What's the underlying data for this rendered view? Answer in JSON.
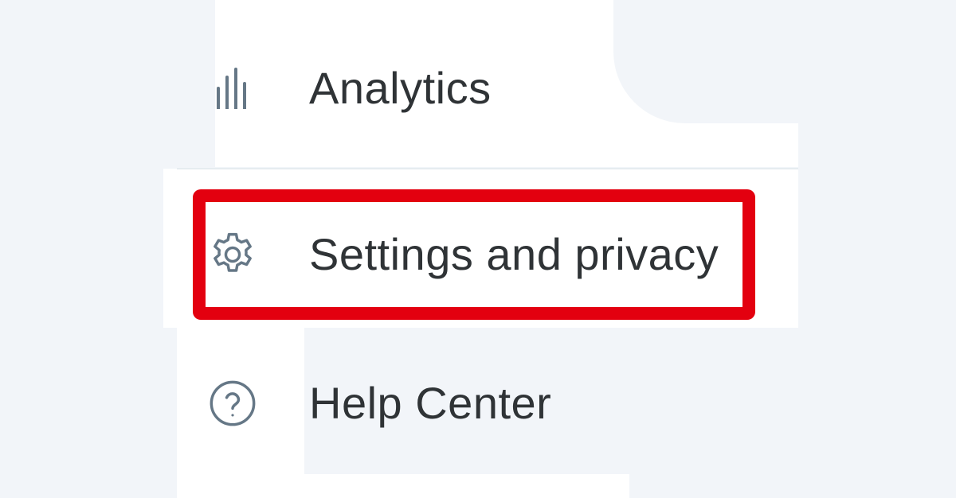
{
  "menu": {
    "items": [
      {
        "label": "Analytics",
        "icon": "bar-chart-icon"
      },
      {
        "label": "Settings and privacy",
        "icon": "gear-icon",
        "highlighted": true
      },
      {
        "label": "Help Center",
        "icon": "question-circle-icon"
      }
    ]
  },
  "colors": {
    "background": "#f2f5f9",
    "panel": "#ffffff",
    "text": "#2f3336",
    "icon": "#657786",
    "highlight": "#e3000f"
  }
}
